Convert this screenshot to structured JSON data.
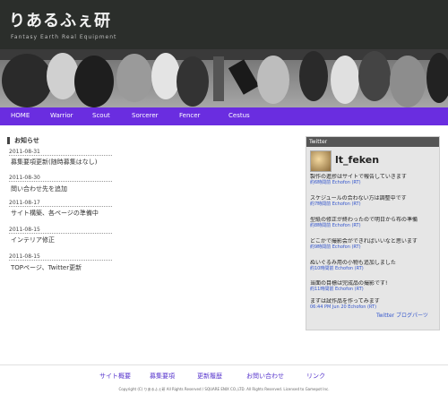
{
  "site": {
    "title": "りあるふぇ研",
    "tagline": "Fantasy Earth Real Equipment"
  },
  "nav": {
    "items": [
      "HOME",
      "Warrior",
      "Scout",
      "Sorcerer",
      "Fencer",
      "Cestus"
    ]
  },
  "news": {
    "heading": "お知らせ",
    "items": [
      {
        "date": "2011-08-31",
        "title": "募集要項更新(随時募集はなし)"
      },
      {
        "date": "2011-08-30",
        "title": "問い合わせ先を追加"
      },
      {
        "date": "2011-08-17",
        "title": "サイト構築、各ページの準備中"
      },
      {
        "date": "2011-08-15",
        "title": "インテリア修正"
      },
      {
        "date": "2011-08-15",
        "title": "TOPページ、Twitter更新"
      }
    ]
  },
  "twitter": {
    "header": "Twitter",
    "account": "lt_feken",
    "tweets": [
      {
        "text": "製作の進捗はサイトで報告していきます",
        "meta": "約6時間前 Echofon (RT)"
      },
      {
        "text": "スケジュールの合わない方は調整中です",
        "meta": "約7時間前 Echofon (RT)"
      },
      {
        "text": "型紙の修正が終わったので明日から布の準備",
        "meta": "約8時間前 Echofon (RT)"
      },
      {
        "text": "どこかで撮影会ができればいいなと思います",
        "meta": "約9時間前 Echofon (RT)"
      },
      {
        "text": "ぬいぐるみ用の小物も追加しました",
        "meta": "約10時間前 Echofon (RT)"
      },
      {
        "text": "当面の目標は完成品の撮影です!",
        "meta": "約11時間前 Echofon (RT)"
      },
      {
        "text": "まずは試作品を作ってみます",
        "meta": "06:44 PM Jun 20 Echofon (RT)"
      }
    ],
    "footer": "Twitter ブログパーツ"
  },
  "footer": {
    "links": [
      "サイト概要",
      "募集要項",
      "更新履歴",
      "お問い合わせ",
      "リンク"
    ],
    "copyright": "Copyright (C) りあるふぇ研 All Rights Reserved / SQUARE ENIX CO.,LTD. All Rights Reserved. Licensed to Gamepot Inc."
  },
  "colors": {
    "nav_bg": "#6a2de0",
    "header_bg": "#2b2e2b",
    "link": "#3355cc"
  }
}
